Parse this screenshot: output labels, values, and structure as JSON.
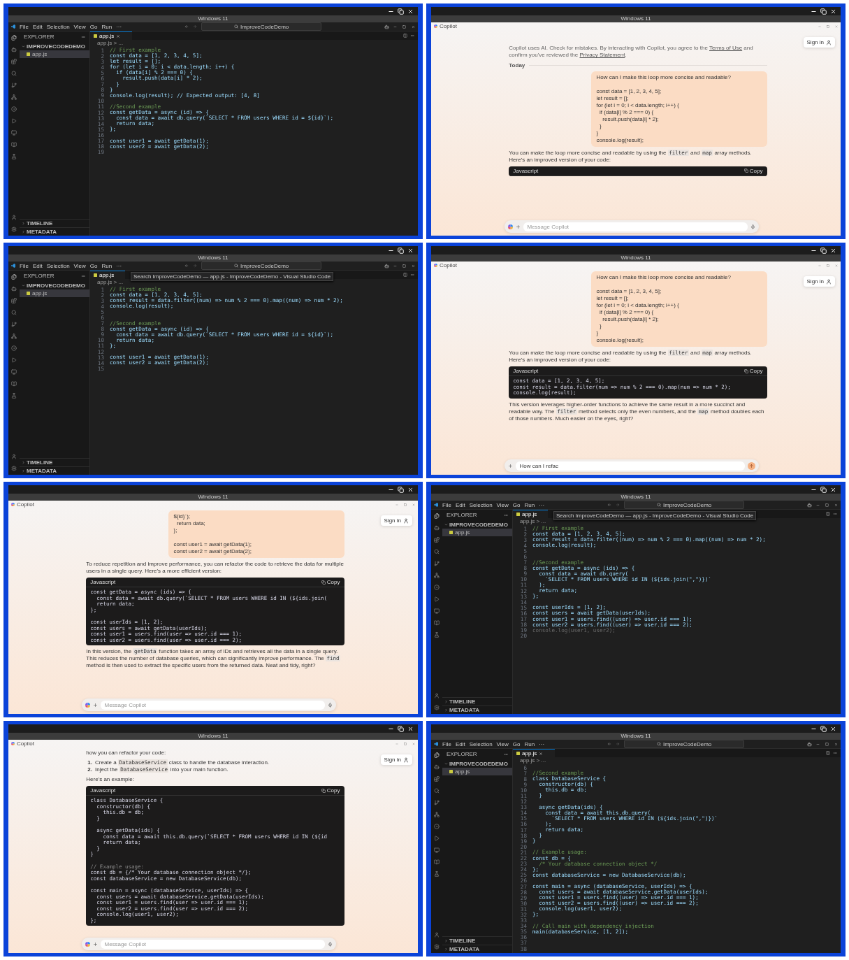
{
  "frames": [
    {
      "kind": "vscode",
      "host_title": "Windows 11",
      "menu": [
        "File",
        "Edit",
        "Selection",
        "View",
        "Go",
        "Run",
        "···"
      ],
      "search": "ImproveCodeDemo",
      "explorer": {
        "title": "EXPLORER",
        "folder": "IMPROVECODEDEMO",
        "files": [
          {
            "name": "app.js",
            "selected": true
          }
        ],
        "sections": [
          "TIMELINE",
          "METADATA"
        ]
      },
      "tab": {
        "label": "app.js",
        "close_visible": true
      },
      "breadcrumb": "app.js > ...",
      "lines": [
        {
          "n": "1",
          "kind": "comment",
          "text": "// First example"
        },
        {
          "n": "2",
          "kind": "code",
          "text": "const data = [1, 2, 3, 4, 5];"
        },
        {
          "n": "3",
          "kind": "code",
          "text": "let result = [];"
        },
        {
          "n": "4",
          "kind": "code",
          "text": "for (let i = 0; i < data.length; i++) {"
        },
        {
          "n": "5",
          "kind": "code",
          "text": "  if (data[i] % 2 === 0) {"
        },
        {
          "n": "6",
          "kind": "code",
          "text": "    result.push(data[i] * 2);"
        },
        {
          "n": "7",
          "kind": "code",
          "text": "  }"
        },
        {
          "n": "8",
          "kind": "code",
          "text": "}"
        },
        {
          "n": "9",
          "kind": "code",
          "text": "console.log(result); // Expected output: [4, 8]"
        },
        {
          "n": "10",
          "kind": "blank"
        },
        {
          "n": "11",
          "kind": "comment",
          "text": "//Second example"
        },
        {
          "n": "12",
          "kind": "code",
          "text": "const getData = async (id) => {"
        },
        {
          "n": "13",
          "kind": "code",
          "text": "  const data = await db.query(`SELECT * FROM users WHERE id = ${id}`);"
        },
        {
          "n": "14",
          "kind": "code",
          "text": "  return data;"
        },
        {
          "n": "15",
          "kind": "code",
          "text": "};"
        },
        {
          "n": "16",
          "kind": "blank"
        },
        {
          "n": "17",
          "kind": "code",
          "text": "const user1 = await getData(1);"
        },
        {
          "n": "18",
          "kind": "code",
          "text": "const user2 = await getData(2);"
        },
        {
          "n": "19",
          "kind": "blank"
        }
      ]
    },
    {
      "kind": "copilot",
      "host_title": "Windows 11",
      "app_title": "Copilot",
      "sign_in": "Sign in",
      "chat": [
        {
          "kind": "notice",
          "parts": [
            {
              "kind": "text",
              "text": "Copilot uses AI. Check for mistakes. By interacting with Copilot, you agree to the "
            },
            {
              "kind": "link",
              "text": "Terms of Use"
            },
            {
              "kind": "text",
              "text": " and confirm you've reviewed the "
            },
            {
              "kind": "link",
              "text": "Privacy Statement"
            },
            {
              "kind": "text",
              "text": "."
            }
          ]
        },
        {
          "kind": "divider",
          "label": "Today"
        },
        {
          "kind": "user",
          "blocks": [
            [
              "How can I make this loop more concise and readable?"
            ],
            [
              "const data = [1, 2, 3, 4, 5];",
              "let result = [];",
              "for (let i = 0; i < data.length; i++) {",
              "  if (data[i] % 2 === 0) {",
              "    result.push(data[i] * 2);",
              "  }",
              "}",
              "console.log(result);"
            ]
          ]
        },
        {
          "kind": "text",
          "parts": [
            {
              "kind": "text",
              "text": "You can make the loop more concise and readable by using the "
            },
            {
              "kind": "code",
              "text": "filter"
            },
            {
              "kind": "text",
              "text": " and "
            },
            {
              "kind": "code",
              "text": "map"
            },
            {
              "kind": "text",
              "text": " array methods. Here's an improved version of your code:"
            }
          ]
        },
        {
          "kind": "code",
          "language": "Javascript",
          "copy": "Copy"
        }
      ],
      "input": {
        "placeholder": "Message Copilot"
      }
    },
    {
      "kind": "vscode",
      "host_title": "Windows 11",
      "menu": [
        "File",
        "Edit",
        "Selection",
        "View",
        "Go",
        "Run",
        "···"
      ],
      "search": "ImproveCodeDemo",
      "tooltip": "Search ImproveCodeDemo — app.js - ImproveCodeDemo - Visual Studio Code",
      "explorer": {
        "title": "EXPLORER",
        "folder": "IMPROVECODEDEMO",
        "files": [
          {
            "name": "app.js",
            "selected": true
          }
        ],
        "sections": [
          "TIMELINE",
          "METADATA"
        ]
      },
      "tab": {
        "label": "app.js",
        "close_visible": false
      },
      "breadcrumb": "app.js > ...",
      "lines": [
        {
          "n": "1",
          "kind": "comment",
          "text": "// First example"
        },
        {
          "n": "2",
          "kind": "code",
          "text": "const data = [1, 2, 3, 4, 5];"
        },
        {
          "n": "3",
          "kind": "code",
          "text": "const result = data.filter((num) => num % 2 === 0).map((num) => num * 2);"
        },
        {
          "n": "4",
          "kind": "code",
          "text": "console.log(result);"
        },
        {
          "n": "5",
          "kind": "blank"
        },
        {
          "n": "6",
          "kind": "blank"
        },
        {
          "n": "7",
          "kind": "comment",
          "text": "//Second example"
        },
        {
          "n": "8",
          "kind": "code",
          "text": "const getData = async (id) => {"
        },
        {
          "n": "9",
          "kind": "code",
          "text": "  const data = await db.query(`SELECT * FROM users WHERE id = ${id}`);"
        },
        {
          "n": "10",
          "kind": "code",
          "text": "  return data;"
        },
        {
          "n": "11",
          "kind": "code",
          "text": "};"
        },
        {
          "n": "12",
          "kind": "blank"
        },
        {
          "n": "13",
          "kind": "code",
          "text": "const user1 = await getData(1);"
        },
        {
          "n": "14",
          "kind": "code",
          "text": "const user2 = await getData(2);"
        },
        {
          "n": "15",
          "kind": "blank"
        }
      ]
    },
    {
      "kind": "copilot",
      "host_title": "Windows 11",
      "app_title": "Copilot",
      "sign_in": "Sign in",
      "chat": [
        {
          "kind": "user",
          "blocks": [
            [
              "How can I make this loop more concise and readable?"
            ],
            [
              "const data = [1, 2, 3, 4, 5];",
              "let result = [];",
              "for (let i = 0; i < data.length; i++) {",
              "  if (data[i] % 2 === 0) {",
              "    result.push(data[i] * 2);",
              "  }",
              "}",
              "console.log(result);"
            ]
          ]
        },
        {
          "kind": "text",
          "parts": [
            {
              "kind": "text",
              "text": "You can make the loop more concise and readable by using the "
            },
            {
              "kind": "code",
              "text": "filter"
            },
            {
              "kind": "text",
              "text": " and "
            },
            {
              "kind": "code",
              "text": "map"
            },
            {
              "kind": "text",
              "text": " array methods. Here's an improved version of your code:"
            }
          ]
        },
        {
          "kind": "code",
          "language": "Javascript",
          "copy": "Copy",
          "lines": [
            {
              "kind": "code",
              "text": "const data = [1, 2, 3, 4, 5];"
            },
            {
              "kind": "code",
              "text": "const result = data.filter(num => num % 2 === 0).map(num => num * 2);"
            },
            {
              "kind": "code",
              "text": "console.log(result);"
            }
          ]
        },
        {
          "kind": "text",
          "parts": [
            {
              "kind": "text",
              "text": "This version leverages higher-order functions to achieve the same result in a more succinct and readable way. The "
            },
            {
              "kind": "code",
              "text": "filter"
            },
            {
              "kind": "text",
              "text": " method selects only the even numbers, and the "
            },
            {
              "kind": "code",
              "text": "map"
            },
            {
              "kind": "text",
              "text": " method doubles each of those numbers. Much easier on the eyes, right?"
            }
          ]
        }
      ],
      "input": {
        "value": "How can I refac"
      }
    },
    {
      "kind": "copilot",
      "host_title": "Windows 11",
      "app_title": "Copilot",
      "sign_in": "Sign in",
      "chat": [
        {
          "kind": "user",
          "blocks": [
            [
              "${id}`);",
              "  return data;",
              "};"
            ],
            [
              "const user1 = await getData(1);",
              "const user2 = await getData(2);"
            ]
          ]
        },
        {
          "kind": "text",
          "parts": [
            {
              "kind": "text",
              "text": "To reduce repetition and improve performance, you can refactor the code to retrieve the data for multiple users in a single query. Here's a more efficient version:"
            }
          ]
        },
        {
          "kind": "code",
          "language": "Javascript",
          "copy": "Copy",
          "lines": [
            {
              "kind": "code",
              "text": "const getData = async (ids) => {"
            },
            {
              "kind": "code",
              "text": "  const data = await db.query(`SELECT * FROM users WHERE id IN (${ids.join("
            },
            {
              "kind": "code",
              "text": "  return data;"
            },
            {
              "kind": "code",
              "text": "};"
            },
            {
              "kind": "blank"
            },
            {
              "kind": "code",
              "text": "const userIds = [1, 2];"
            },
            {
              "kind": "code",
              "text": "const users = await getData(userIds);"
            },
            {
              "kind": "code",
              "text": "const user1 = users.find(user => user.id === 1);"
            },
            {
              "kind": "code",
              "text": "const user2 = users.find(user => user.id === 2);"
            }
          ]
        },
        {
          "kind": "text",
          "parts": [
            {
              "kind": "text",
              "text": "In this version, the "
            },
            {
              "kind": "code",
              "text": "getData"
            },
            {
              "kind": "text",
              "text": " function takes an array of IDs and retrieves all the data in a single query. This reduces the number of database queries, which can significantly improve performance. The "
            },
            {
              "kind": "code",
              "text": "find"
            },
            {
              "kind": "text",
              "text": " method is then used to extract the specific users from the returned data. Neat and tidy, right?"
            }
          ]
        }
      ],
      "input": {
        "placeholder": "Message Copilot"
      }
    },
    {
      "kind": "vscode",
      "host_title": "Windows 11",
      "menu": [
        "File",
        "Edit",
        "Selection",
        "View",
        "Go",
        "Run",
        "···"
      ],
      "search": "ImproveCodeDemo",
      "tooltip": "Search ImproveCodeDemo — app.js - ImproveCodeDemo - Visual Studio Code",
      "explorer": {
        "title": "EXPLORER",
        "folder": "IMPROVECODEDEMO",
        "files": [
          {
            "name": "app.js",
            "selected": true
          }
        ],
        "sections": [
          "TIMELINE",
          "METADATA"
        ]
      },
      "tab": {
        "label": "app.js",
        "close_visible": false
      },
      "breadcrumb": "app.js > ...",
      "lines": [
        {
          "n": "1",
          "kind": "comment",
          "text": "// First example"
        },
        {
          "n": "2",
          "kind": "code",
          "text": "const data = [1, 2, 3, 4, 5];"
        },
        {
          "n": "3",
          "kind": "code",
          "text": "const result = data.filter((num) => num % 2 === 0).map((num) => num * 2);"
        },
        {
          "n": "4",
          "kind": "code",
          "text": "console.log(result);"
        },
        {
          "n": "5",
          "kind": "blank"
        },
        {
          "n": "6",
          "kind": "blank"
        },
        {
          "n": "7",
          "kind": "comment",
          "text": "//Second example"
        },
        {
          "n": "8",
          "kind": "code",
          "text": "const getData = async (ids) => {"
        },
        {
          "n": "9",
          "kind": "code",
          "text": "  const data = await db.query("
        },
        {
          "n": "10",
          "kind": "code",
          "text": "    `SELECT * FROM users WHERE id IN (${ids.join(\",\")})`"
        },
        {
          "n": "11",
          "kind": "code",
          "text": "  );"
        },
        {
          "n": "12",
          "kind": "code",
          "text": "  return data;"
        },
        {
          "n": "13",
          "kind": "code",
          "text": "};"
        },
        {
          "n": "14",
          "kind": "blank"
        },
        {
          "n": "15",
          "kind": "code",
          "text": "const userIds = [1, 2];"
        },
        {
          "n": "16",
          "kind": "code",
          "text": "const users = await getData(userIds);"
        },
        {
          "n": "17",
          "kind": "code",
          "text": "const user1 = users.find((user) => user.id === 1);"
        },
        {
          "n": "18",
          "kind": "code",
          "text": "const user2 = users.find((user) => user.id === 2);"
        },
        {
          "n": "19",
          "kind": "ghost",
          "text": "console.log(user1, user2);"
        },
        {
          "n": "20",
          "kind": "blank"
        }
      ]
    },
    {
      "kind": "copilot",
      "host_title": "Windows 11",
      "app_title": "Copilot",
      "sign_in": "Sign in",
      "chat": [
        {
          "kind": "text",
          "parts": [
            {
              "kind": "text",
              "text": "how you can refactor your code:"
            }
          ]
        },
        {
          "kind": "list",
          "items": [
            {
              "marker": "1.",
              "parts": [
                {
                  "kind": "text",
                  "text": "Create a "
                },
                {
                  "kind": "code",
                  "text": "DatabaseService"
                },
                {
                  "kind": "text",
                  "text": " class to handle the database interaction."
                }
              ]
            },
            {
              "marker": "2.",
              "parts": [
                {
                  "kind": "text",
                  "text": "Inject the "
                },
                {
                  "kind": "code",
                  "text": "DatabaseService"
                },
                {
                  "kind": "text",
                  "text": " into your main function."
                }
              ]
            }
          ]
        },
        {
          "kind": "text",
          "parts": [
            {
              "kind": "text",
              "text": "Here's an example:"
            }
          ]
        },
        {
          "kind": "code",
          "language": "Javascript",
          "copy": "Copy",
          "lines": [
            {
              "kind": "code",
              "text": "class DatabaseService {"
            },
            {
              "kind": "code",
              "text": "  constructor(db) {"
            },
            {
              "kind": "code",
              "text": "    this.db = db;"
            },
            {
              "kind": "code",
              "text": "  }"
            },
            {
              "kind": "blank"
            },
            {
              "kind": "code",
              "text": "  async getData(ids) {"
            },
            {
              "kind": "code",
              "text": "    const data = await this.db.query(`SELECT * FROM users WHERE id IN (${id"
            },
            {
              "kind": "code",
              "text": "    return data;"
            },
            {
              "kind": "code",
              "text": "  }"
            },
            {
              "kind": "code",
              "text": "}"
            },
            {
              "kind": "blank"
            },
            {
              "kind": "comment",
              "text": "// Example usage:"
            },
            {
              "kind": "code",
              "text": "const db = {/* Your database connection object */};"
            },
            {
              "kind": "code",
              "text": "const databaseService = new DatabaseService(db);"
            },
            {
              "kind": "blank"
            },
            {
              "kind": "code",
              "text": "const main = async (databaseService, userIds) => {"
            },
            {
              "kind": "code",
              "text": "  const users = await databaseService.getData(userIds);"
            },
            {
              "kind": "code",
              "text": "  const user1 = users.find(user => user.id === 1);"
            },
            {
              "kind": "code",
              "text": "  const user2 = users.find(user => user.id === 2);"
            },
            {
              "kind": "code",
              "text": "  console.log(user1, user2);"
            },
            {
              "kind": "code",
              "text": "};"
            }
          ]
        }
      ],
      "input": {
        "placeholder": "Message Copilot"
      }
    },
    {
      "kind": "vscode",
      "host_title": "Windows 11",
      "menu": [
        "File",
        "Edit",
        "Selection",
        "View",
        "Go",
        "Run",
        "···"
      ],
      "search": "ImproveCodeDemo",
      "explorer": {
        "title": "EXPLORER",
        "folder": "IMPROVECODEDEMO",
        "files": [
          {
            "name": "app.js",
            "selected": true
          }
        ],
        "sections": [
          "TIMELINE",
          "METADATA"
        ]
      },
      "tab": {
        "label": "app.js",
        "close_visible": true
      },
      "breadcrumb": "app.js > ...",
      "lines": [
        {
          "n": "6",
          "kind": "blank"
        },
        {
          "n": "7",
          "kind": "comment",
          "text": "//Second example"
        },
        {
          "n": "8",
          "kind": "code",
          "text": "class DatabaseService {"
        },
        {
          "n": "9",
          "kind": "code",
          "text": "  constructor(db) {"
        },
        {
          "n": "10",
          "kind": "code",
          "text": "    this.db = db;"
        },
        {
          "n": "11",
          "kind": "code",
          "text": "  }"
        },
        {
          "n": "12",
          "kind": "blank"
        },
        {
          "n": "13",
          "kind": "code",
          "text": "  async getData(ids) {"
        },
        {
          "n": "14",
          "kind": "code",
          "text": "    const data = await this.db.query("
        },
        {
          "n": "15",
          "kind": "code",
          "text": "      `SELECT * FROM users WHERE id IN (${ids.join(\",\")})`"
        },
        {
          "n": "16",
          "kind": "code",
          "text": "    );"
        },
        {
          "n": "17",
          "kind": "code",
          "text": "    return data;"
        },
        {
          "n": "18",
          "kind": "code",
          "text": "  }"
        },
        {
          "n": "19",
          "kind": "code",
          "text": "}"
        },
        {
          "n": "20",
          "kind": "blank"
        },
        {
          "n": "21",
          "kind": "comment",
          "text": "// Example usage:"
        },
        {
          "n": "22",
          "kind": "code",
          "text": "const db = {"
        },
        {
          "n": "23",
          "kind": "comment",
          "text": "  /* Your database connection object */"
        },
        {
          "n": "24",
          "kind": "code",
          "text": "};"
        },
        {
          "n": "25",
          "kind": "code",
          "text": "const databaseService = new DatabaseService(db);"
        },
        {
          "n": "26",
          "kind": "blank"
        },
        {
          "n": "27",
          "kind": "code",
          "text": "const main = async (databaseService, userIds) => {"
        },
        {
          "n": "28",
          "kind": "code",
          "text": "  const users = await databaseService.getData(userIds);"
        },
        {
          "n": "29",
          "kind": "code",
          "text": "  const user1 = users.find((user) => user.id === 1);"
        },
        {
          "n": "30",
          "kind": "code",
          "text": "  const user2 = users.find((user) => user.id === 2);"
        },
        {
          "n": "31",
          "kind": "code",
          "text": "  console.log(user1, user2);"
        },
        {
          "n": "32",
          "kind": "code",
          "text": "};"
        },
        {
          "n": "33",
          "kind": "blank"
        },
        {
          "n": "34",
          "kind": "comment",
          "text": "// Call main with dependency injection"
        },
        {
          "n": "35",
          "kind": "code",
          "text": "main(databaseService, [1, 2]);"
        },
        {
          "n": "36",
          "kind": "blank"
        },
        {
          "n": "37",
          "kind": "blank"
        },
        {
          "n": "38",
          "kind": "blank"
        }
      ]
    }
  ]
}
